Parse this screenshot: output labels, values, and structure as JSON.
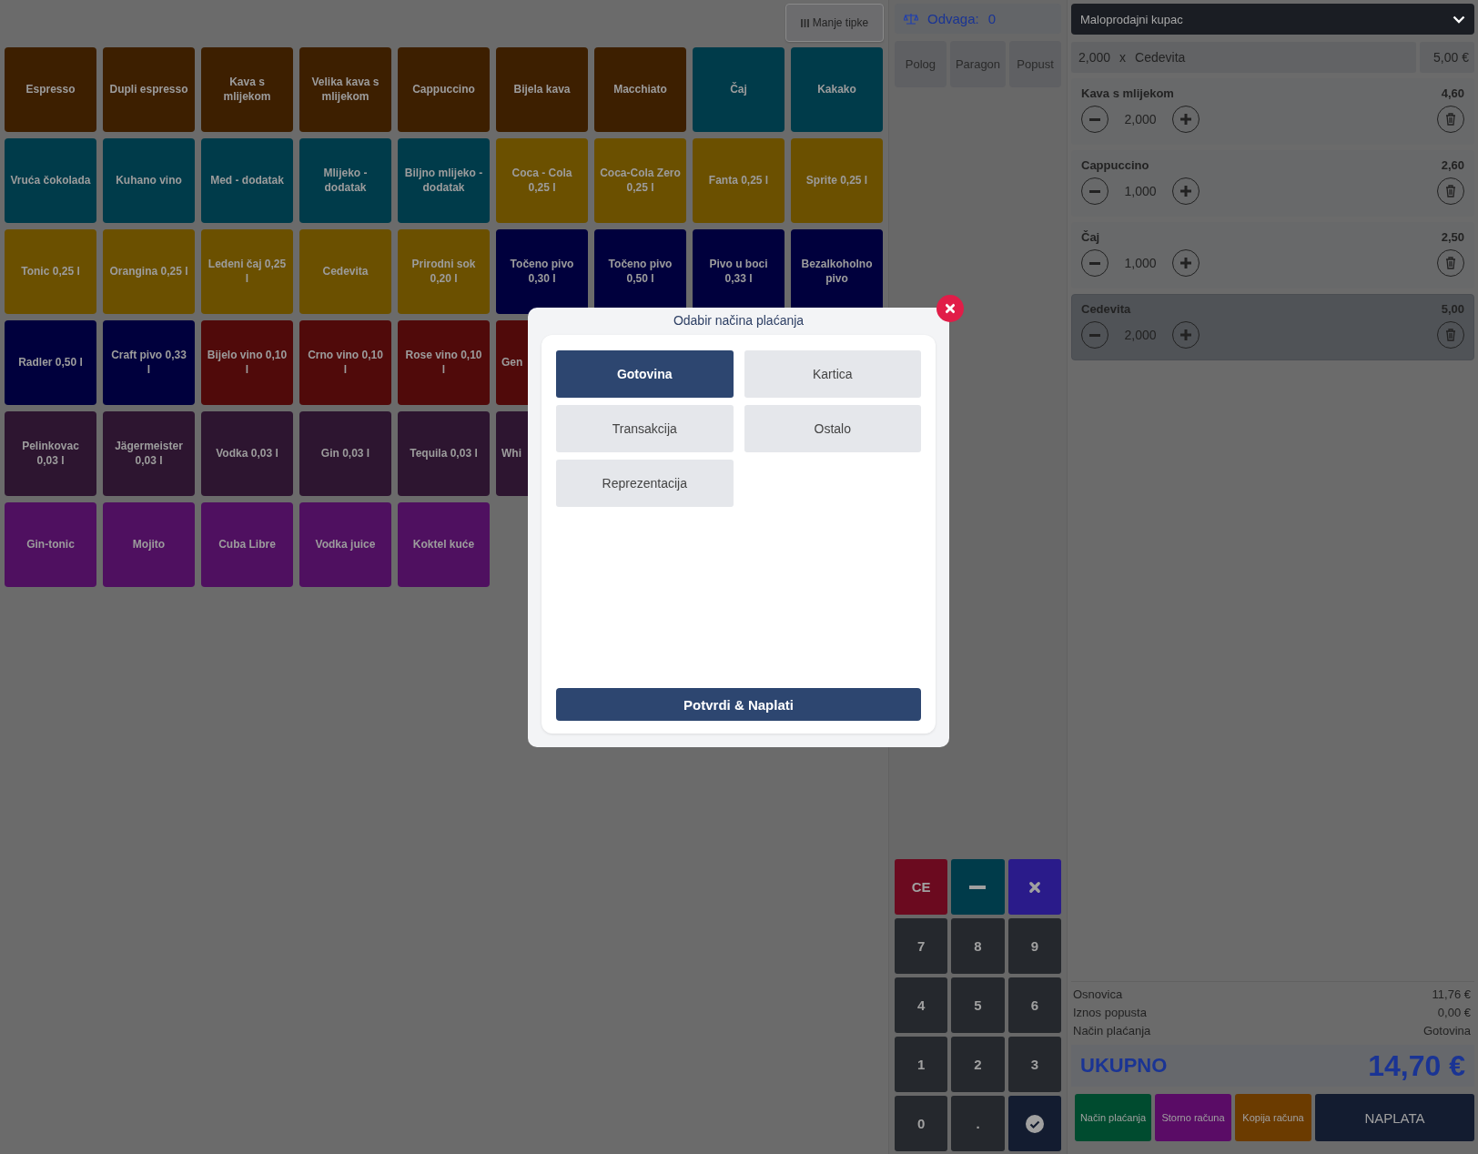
{
  "toolbar": {
    "button": "Manje tipke"
  },
  "tile_rows": [
    [
      {
        "kind": "tile",
        "label": "Espresso",
        "color": "#3d1f00"
      },
      {
        "kind": "tile",
        "label": "Dupli espresso",
        "color": "#3d1f00"
      },
      {
        "kind": "tile",
        "label": "Kava s mlijekom",
        "color": "#3d1f00"
      },
      {
        "kind": "tile",
        "label": "Velika kava s mlijekom",
        "color": "#3d1f00"
      },
      {
        "kind": "tile",
        "label": "Cappuccino",
        "color": "#3d1f00"
      },
      {
        "kind": "tile",
        "label": "Bijela kava",
        "color": "#3d1f00"
      },
      {
        "kind": "tile",
        "label": "Macchiato",
        "color": "#3d1f00"
      },
      {
        "kind": "tile",
        "label": "Čaj",
        "color": "#003b4a"
      },
      {
        "kind": "tile",
        "label": "Kakako",
        "color": "#003b4a"
      }
    ],
    [
      {
        "kind": "tile",
        "label": "Vruća čokolada",
        "color": "#003b4a"
      },
      {
        "kind": "tile",
        "label": "Kuhano vino",
        "color": "#003b4a"
      },
      {
        "kind": "tile",
        "label": "Med - dodatak",
        "color": "#003b4a"
      },
      {
        "kind": "tile",
        "label": "Mlijeko - dodatak",
        "color": "#003b4a"
      },
      {
        "kind": "tile",
        "label": "Biljno mlijeko - dodatak",
        "color": "#003b4a"
      },
      {
        "kind": "tile",
        "label": "Coca - Cola 0,25 l",
        "color": "#6b5000"
      },
      {
        "kind": "tile",
        "label": "Coca-Cola Zero 0,25 l",
        "color": "#6b5000"
      },
      {
        "kind": "tile",
        "label": "Fanta 0,25 l",
        "color": "#6b5000"
      },
      {
        "kind": "tile",
        "label": "Sprite 0,25 l",
        "color": "#6b5000"
      }
    ],
    [
      {
        "kind": "tile",
        "label": "Tonic 0,25 l",
        "color": "#6b5000"
      },
      {
        "kind": "tile",
        "label": "Orangina 0,25 l",
        "color": "#6b5000"
      },
      {
        "kind": "tile",
        "label": "Ledeni čaj 0,25 l",
        "color": "#6b5000"
      },
      {
        "kind": "tile",
        "label": "Cedevita",
        "color": "#6b5000"
      },
      {
        "kind": "tile",
        "label": "Prirodni sok 0,20 l",
        "color": "#6b5000"
      },
      {
        "kind": "tile",
        "label": "Točeno pivo 0,30 l",
        "color": "#00003d"
      },
      {
        "kind": "tile",
        "label": "Točeno pivo 0,50 l",
        "color": "#00003d"
      },
      {
        "kind": "tile",
        "label": "Pivo u boci 0,33 l",
        "color": "#00003d"
      },
      {
        "kind": "tile",
        "label": "Bezalkoholno pivo",
        "color": "#00003d"
      }
    ],
    [
      {
        "kind": "tile",
        "label": "Radler 0,50 l",
        "color": "#00003d"
      },
      {
        "kind": "tile",
        "label": "Craft pivo 0,33 l",
        "color": "#00003d"
      },
      {
        "kind": "tile",
        "label": "Bijelo vino 0,10 l",
        "color": "#500a0a"
      },
      {
        "kind": "tile",
        "label": "Crno vino 0,10 l",
        "color": "#500a0a"
      },
      {
        "kind": "tile",
        "label": "Rose vino 0,10 l",
        "color": "#500a0a"
      },
      {
        "kind": "cut",
        "label": "Gen",
        "color": "#500a0a"
      }
    ],
    [
      {
        "kind": "tile",
        "label": "Pelinkovac 0,03 l",
        "color": "#2d1530"
      },
      {
        "kind": "tile",
        "label": "Jägermeister 0,03 l",
        "color": "#2d1530"
      },
      {
        "kind": "tile",
        "label": "Vodka 0,03 l",
        "color": "#2d1530"
      },
      {
        "kind": "tile",
        "label": "Gin 0,03 l",
        "color": "#2d1530"
      },
      {
        "kind": "tile",
        "label": "Tequila 0,03 l",
        "color": "#2d1530"
      },
      {
        "kind": "cut",
        "label": "Whi",
        "color": "#2d1530"
      }
    ],
    [
      {
        "kind": "tile",
        "label": "Gin-tonic",
        "color": "#4f1060"
      },
      {
        "kind": "tile",
        "label": "Mojito",
        "color": "#4f1060"
      },
      {
        "kind": "tile",
        "label": "Cuba Libre",
        "color": "#4f1060"
      },
      {
        "kind": "tile",
        "label": "Vodka juice",
        "color": "#4f1060"
      },
      {
        "kind": "tile",
        "label": "Koktel kuće",
        "color": "#4f1060"
      }
    ]
  ],
  "scale": {
    "label": "Odvaga:",
    "value": "0"
  },
  "actions": [
    "Polog",
    "Paragon",
    "Popust"
  ],
  "keypad": [
    {
      "kind": "ce",
      "label": "CE"
    },
    {
      "kind": "minus"
    },
    {
      "kind": "times"
    },
    {
      "kind": "digit",
      "label": "7"
    },
    {
      "kind": "digit",
      "label": "8"
    },
    {
      "kind": "digit",
      "label": "9"
    },
    {
      "kind": "digit",
      "label": "4"
    },
    {
      "kind": "digit",
      "label": "5"
    },
    {
      "kind": "digit",
      "label": "6"
    },
    {
      "kind": "digit",
      "label": "1"
    },
    {
      "kind": "digit",
      "label": "2"
    },
    {
      "kind": "digit",
      "label": "3"
    },
    {
      "kind": "digit",
      "label": "0"
    },
    {
      "kind": "digit",
      "label": "."
    },
    {
      "kind": "confirm"
    }
  ],
  "customer": {
    "value": "Maloprodajni kupac"
  },
  "current_line": {
    "quantity": "2,000",
    "times": "x",
    "product": "Cedevita",
    "price": "5,00 €"
  },
  "order_items": [
    {
      "name": "Kava s mlijekom",
      "price": "4,60",
      "quantity": "2,000",
      "selected": false
    },
    {
      "name": "Cappuccino",
      "price": "2,60",
      "quantity": "1,000",
      "selected": false
    },
    {
      "name": "Čaj",
      "price": "2,50",
      "quantity": "1,000",
      "selected": false
    },
    {
      "name": "Cedevita",
      "price": "5,00",
      "quantity": "2,000",
      "selected": true
    }
  ],
  "summary": [
    {
      "label": "Osnovica",
      "value": "11,76 €"
    },
    {
      "label": "Iznos popusta",
      "value": "0,00 €"
    },
    {
      "label": "Način plaćanja",
      "value": "Gotovina"
    }
  ],
  "total": {
    "label": "UKUPNO",
    "value": "14,70 €"
  },
  "bottom_buttons": [
    {
      "label": "Način plaćanja",
      "color": "#004b2f"
    },
    {
      "label": "Storno računa",
      "color": "#5a0c66"
    },
    {
      "label": "Kopija računa",
      "color": "#6b3b00"
    },
    {
      "label": "NAPLATA",
      "color": "#131c30"
    }
  ],
  "dialog": {
    "title": "Odabir načina plaćanja",
    "methods": [
      {
        "label": "Gotovina",
        "selected": true
      },
      {
        "label": "Kartica",
        "selected": false
      },
      {
        "label": "Transakcija",
        "selected": false
      },
      {
        "label": "Ostalo",
        "selected": false
      },
      {
        "label": "Reprezentacija",
        "selected": false
      }
    ],
    "confirm": "Potvrdi & Naplati"
  }
}
